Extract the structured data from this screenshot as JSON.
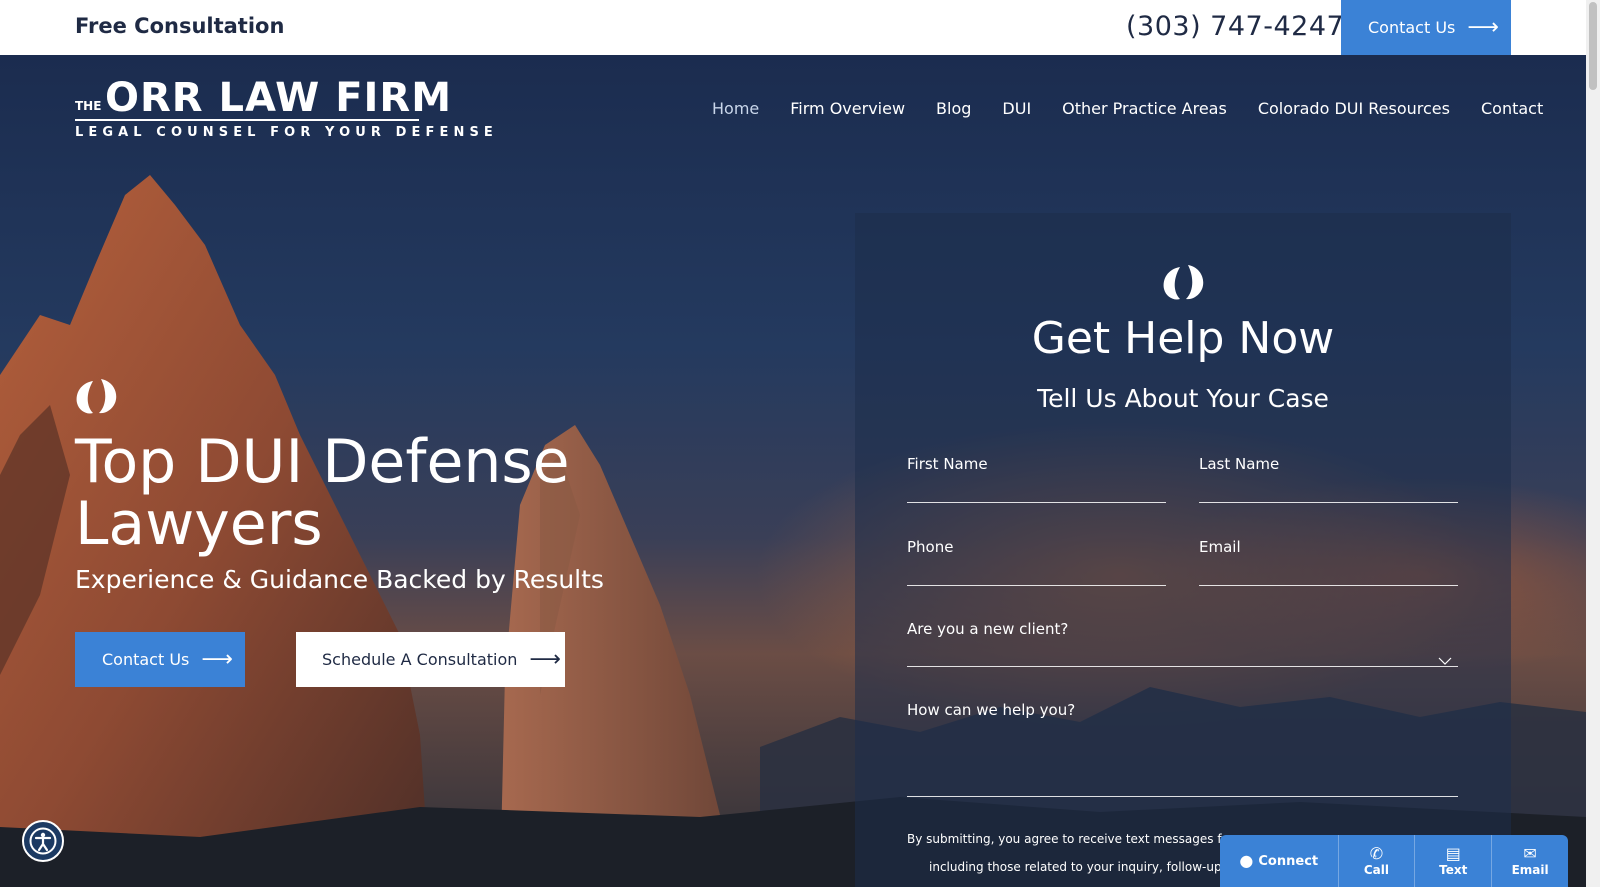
{
  "topbar": {
    "free_consultation": "Free Consultation",
    "phone": "(303) 747-4247",
    "contact_label": "Contact Us"
  },
  "logo": {
    "the": "THE",
    "name": "ORR LAW FIRM",
    "tagline": "LEGAL COUNSEL FOR YOUR DEFENSE"
  },
  "nav": {
    "items": [
      {
        "label": "Home",
        "active": true
      },
      {
        "label": "Firm Overview"
      },
      {
        "label": "Blog"
      },
      {
        "label": "DUI"
      },
      {
        "label": "Other Practice Areas"
      },
      {
        "label": "Colorado DUI Resources"
      },
      {
        "label": "Contact"
      }
    ]
  },
  "hero": {
    "heading": "Top DUI Defense Lawyers",
    "subheading": "Experience & Guidance Backed by Results",
    "contact_button": "Contact Us",
    "schedule_button": "Schedule A Consultation"
  },
  "form": {
    "title": "Get Help Now",
    "subtitle": "Tell Us About Your Case",
    "first_name": "First Name",
    "last_name": "Last Name",
    "phone": "Phone",
    "email": "Email",
    "new_client": "Are you a new client?",
    "help": "How can we help you?",
    "disclaimer_line1": "By submitting, you agree to receive text messages fro",
    "disclaimer_line2": "including those related to your inquiry, follow-ups"
  },
  "widget": {
    "connect": "Connect",
    "call": "Call",
    "text": "Text",
    "email": "Email"
  },
  "colors": {
    "accent": "#3b82d6",
    "navy": "#1f2a44"
  }
}
